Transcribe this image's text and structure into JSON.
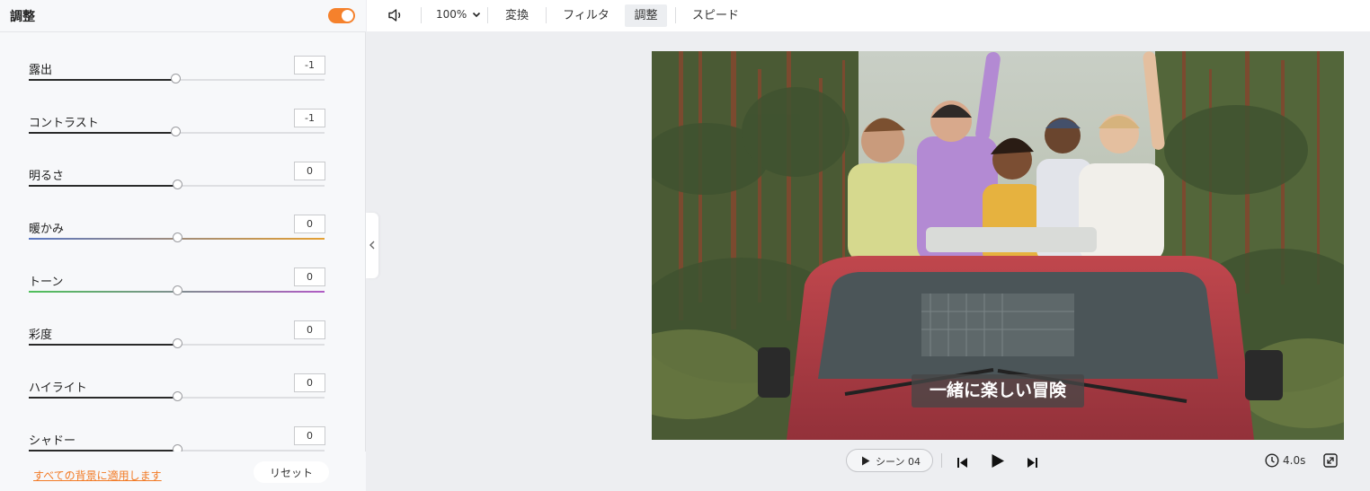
{
  "panel": {
    "title": "調整",
    "toggle_on": true,
    "sliders": [
      {
        "label": "露出",
        "value": "-1",
        "position": 0.494,
        "track": "default"
      },
      {
        "label": "コントラスト",
        "value": "-1",
        "position": 0.494,
        "track": "default"
      },
      {
        "label": "明るさ",
        "value": "0",
        "position": 0.5,
        "track": "default"
      },
      {
        "label": "暖かみ",
        "value": "0",
        "position": 0.5,
        "track": "warmth"
      },
      {
        "label": "トーン",
        "value": "0",
        "position": 0.5,
        "track": "tone"
      },
      {
        "label": "彩度",
        "value": "0",
        "position": 0.5,
        "track": "default"
      },
      {
        "label": "ハイライト",
        "value": "0",
        "position": 0.5,
        "track": "default"
      },
      {
        "label": "シャドー",
        "value": "0",
        "position": 0.5,
        "track": "default"
      }
    ],
    "apply_all_label": "すべての背景に適用します",
    "reset_label": "リセット"
  },
  "toolbar": {
    "zoom": "100%",
    "tabs": [
      "変換",
      "フィルタ",
      "調整",
      "スピード"
    ],
    "active_tab": "調整"
  },
  "preview": {
    "subtitle": "一緒に楽しい冒険"
  },
  "playback": {
    "scene_label": "シーン 04",
    "duration": "4.0s"
  },
  "icons": {
    "volume": "speaker-icon",
    "zoom_dropdown": "chevron-down-icon",
    "collapse": "chevron-left-icon",
    "scene_play": "play-icon",
    "prev": "skip-previous-icon",
    "play": "play-icon",
    "next": "skip-next-icon",
    "clock": "clock-icon",
    "fullscreen": "fullscreen-icon"
  },
  "colors": {
    "accent": "#f5812c",
    "link": "#f27a25",
    "warmth_start": "#5b78c2",
    "warmth_end": "#e5a032",
    "tone_start": "#4fc05a",
    "tone_end": "#b05cc4"
  }
}
